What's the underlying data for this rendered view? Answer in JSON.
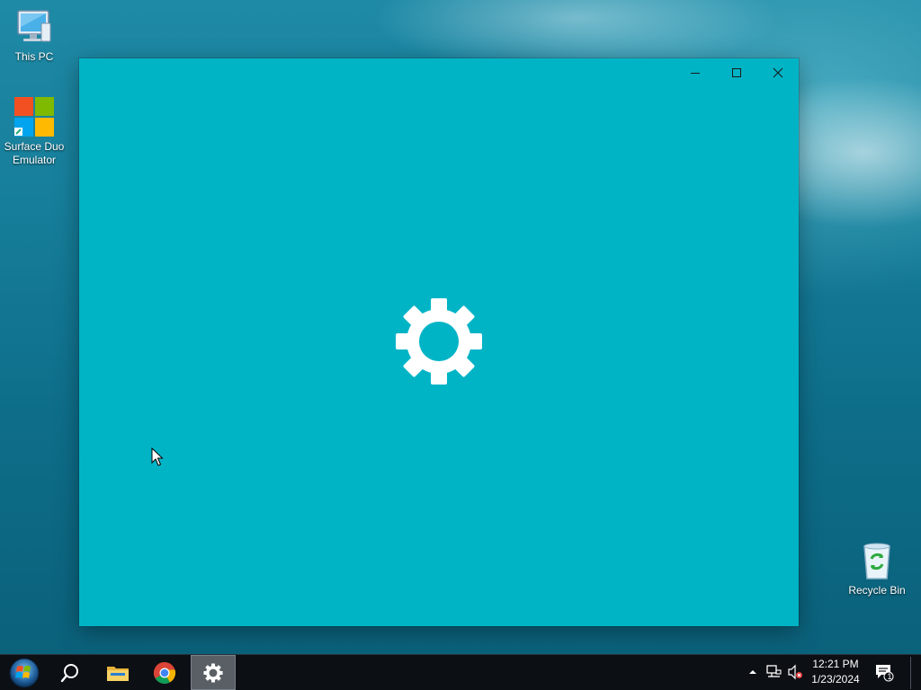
{
  "desktop": {
    "icons": [
      {
        "label": "This PC"
      },
      {
        "label": "Surface Duo\nEmulator"
      },
      {
        "label": "Recycle Bin"
      }
    ]
  },
  "window": {
    "background_color": "#00b4c6",
    "controls": {
      "minimize": "minimize-icon",
      "maximize": "maximize-icon",
      "close": "close-icon"
    },
    "splash_icon": "gear-icon"
  },
  "taskbar": {
    "pinned": [
      {
        "name": "start-button",
        "icon": "windows-logo-icon"
      },
      {
        "name": "search-button",
        "icon": "search-icon"
      },
      {
        "name": "file-explorer",
        "icon": "folder-icon"
      },
      {
        "name": "chrome",
        "icon": "chrome-icon"
      },
      {
        "name": "settings",
        "icon": "gear-icon",
        "active": true
      }
    ],
    "tray": {
      "icons": [
        "chevron-up-icon",
        "network-icon",
        "volume-muted-icon"
      ],
      "time": "12:21 PM",
      "date": "1/23/2024",
      "notification_count": "1"
    }
  }
}
